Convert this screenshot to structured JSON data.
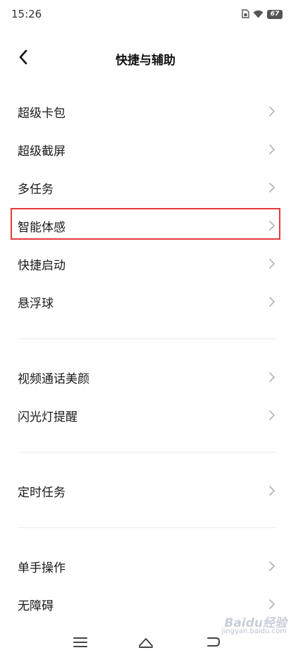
{
  "status_bar": {
    "time": "15:26",
    "battery_level": "67",
    "icons": [
      "sim-icon",
      "wifi-icon",
      "battery-icon"
    ]
  },
  "header": {
    "back_icon": "chevron-left-icon",
    "title": "快捷与辅助"
  },
  "groups": [
    {
      "items": [
        {
          "label": "超级卡包"
        },
        {
          "label": "超级截屏"
        },
        {
          "label": "多任务"
        },
        {
          "label": "智能体感",
          "highlighted": true
        },
        {
          "label": "快捷启动"
        },
        {
          "label": "悬浮球"
        }
      ]
    },
    {
      "items": [
        {
          "label": "视频通话美颜"
        },
        {
          "label": "闪光灯提醒"
        }
      ]
    },
    {
      "items": [
        {
          "label": "定时任务"
        }
      ]
    },
    {
      "items": [
        {
          "label": "单手操作"
        },
        {
          "label": "无障碍"
        }
      ]
    }
  ],
  "nav_bar": {
    "buttons": [
      "menu-icon",
      "home-icon",
      "back-icon"
    ]
  },
  "watermark": {
    "logo_text": "Baidu经验",
    "url": "jingyan.baidu.com"
  },
  "colors": {
    "highlight": "#e5393b",
    "divider": "#ececec",
    "chevron": "#b3b3b3"
  }
}
